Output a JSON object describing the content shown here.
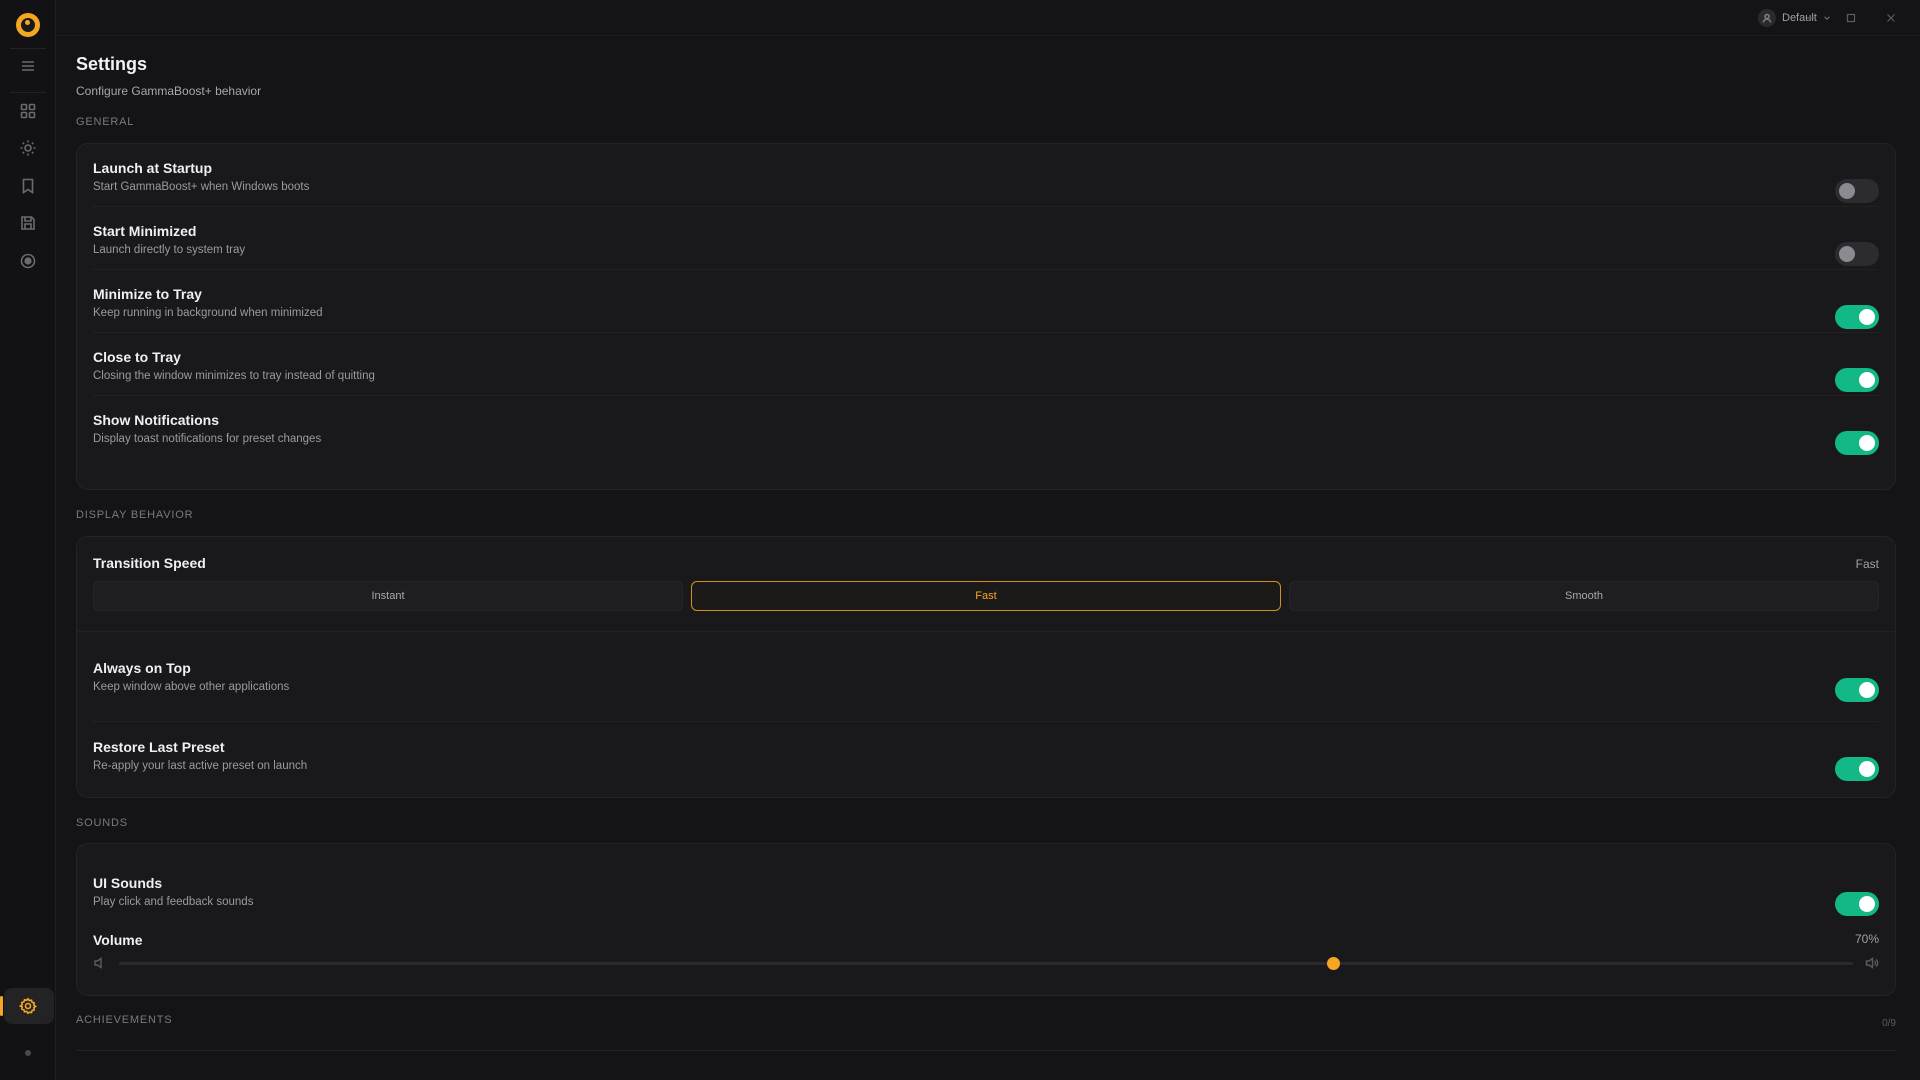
{
  "app": {
    "profile_name": "Default",
    "colors": {
      "accent": "#f5a623",
      "toggle_on": "#12b886",
      "background": "#141416",
      "card": "#19191b"
    }
  },
  "sidebar": {
    "items": [
      {
        "icon": "menu-icon"
      },
      {
        "icon": "grid-icon"
      },
      {
        "icon": "sun-icon"
      },
      {
        "icon": "bookmark-icon"
      },
      {
        "icon": "save-icon"
      },
      {
        "icon": "record-icon"
      },
      {
        "icon": "settings-gear-icon",
        "active": true
      }
    ]
  },
  "page": {
    "title": "Settings",
    "subtitle": "Configure GammaBoost+ behavior"
  },
  "general": {
    "label": "GENERAL",
    "items": [
      {
        "title": "Launch at Startup",
        "desc": "Start GammaBoost+ when Windows boots",
        "on": false
      },
      {
        "title": "Start Minimized",
        "desc": "Launch directly to system tray",
        "on": false
      },
      {
        "title": "Minimize to Tray",
        "desc": "Keep running in background when minimized",
        "on": true
      },
      {
        "title": "Close to Tray",
        "desc": "Closing the window minimizes to tray instead of quitting",
        "on": true
      },
      {
        "title": "Show Notifications",
        "desc": "Display toast notifications for preset changes",
        "on": true
      }
    ]
  },
  "display": {
    "label": "DISPLAY BEHAVIOR",
    "transition": {
      "title": "Transition Speed",
      "value": "Fast",
      "options": [
        "Instant",
        "Fast",
        "Smooth"
      ],
      "selected": "Fast"
    },
    "items": [
      {
        "title": "Always on Top",
        "desc": "Keep window above other applications",
        "on": true
      },
      {
        "title": "Restore Last Preset",
        "desc": "Re-apply your last active preset on launch",
        "on": true
      }
    ]
  },
  "sounds": {
    "label": "SOUNDS",
    "ui_sounds": {
      "title": "UI Sounds",
      "desc": "Play click and feedback sounds",
      "on": true
    },
    "volume": {
      "title": "Volume",
      "value_text": "70%",
      "value": 70
    }
  },
  "achievements": {
    "label": "ACHIEVEMENTS",
    "count": "0/9"
  }
}
